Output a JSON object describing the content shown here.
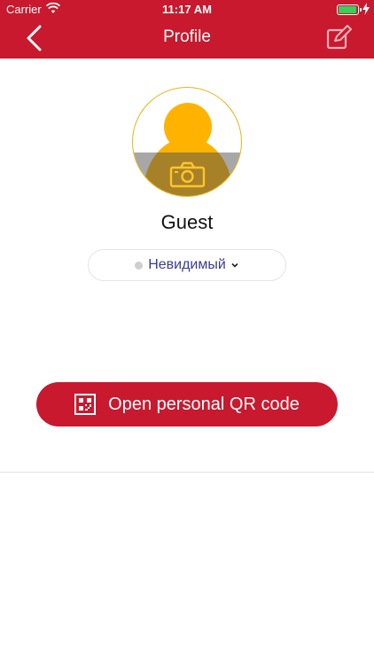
{
  "status_bar": {
    "carrier": "Carrier",
    "time": "11:17 AM"
  },
  "nav": {
    "title": "Profile"
  },
  "profile": {
    "name": "Guest",
    "status": "Невидимый"
  },
  "actions": {
    "qr_button_label": "Open personal QR code"
  },
  "colors": {
    "brand": "#c8192e",
    "avatar": "#ffb300",
    "status_text": "#3c3c8c"
  },
  "icons": [
    "wifi-icon",
    "battery-icon",
    "charging-bolt-icon",
    "back-chevron-icon",
    "edit-icon",
    "avatar-silhouette-icon",
    "camera-icon",
    "chevron-down-icon",
    "qr-code-icon"
  ]
}
